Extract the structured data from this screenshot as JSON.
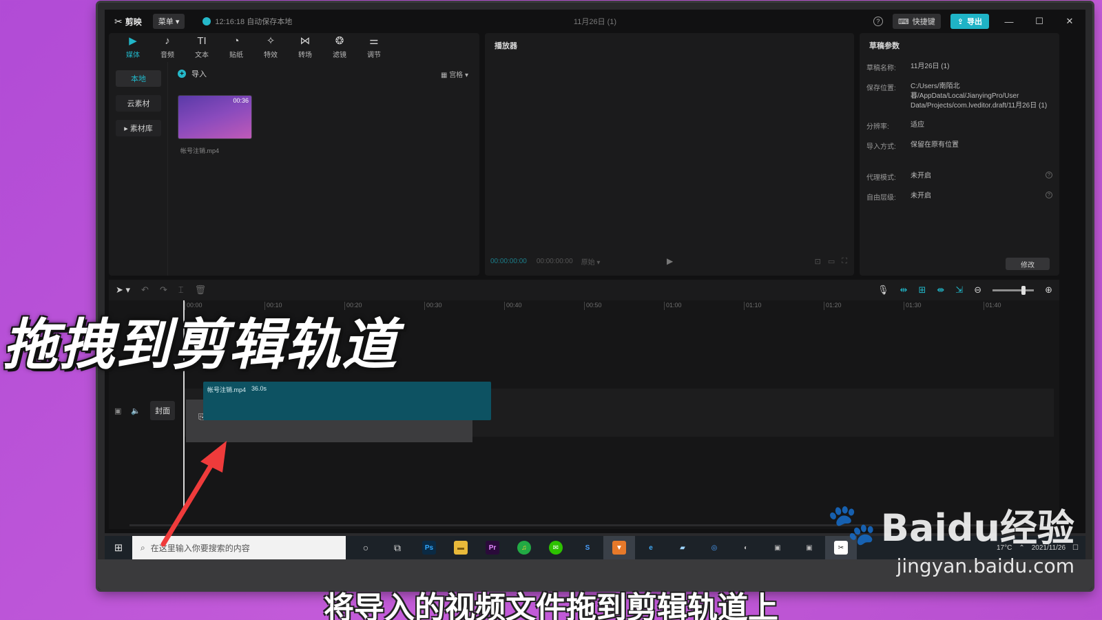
{
  "titlebar": {
    "app_name": "剪映",
    "menu_label": "菜单",
    "saved_status": "12:16:18 自动保存本地",
    "project_title": "11月26日 (1)",
    "shortcut_label": "快捷键",
    "export_label": "导出"
  },
  "media_tabs": [
    {
      "label": "媒体",
      "icon": "media-icon",
      "glyph": "▶"
    },
    {
      "label": "音频",
      "icon": "audio-icon",
      "glyph": "♪"
    },
    {
      "label": "文本",
      "icon": "text-icon",
      "glyph": "TI"
    },
    {
      "label": "贴纸",
      "icon": "sticker-icon",
      "glyph": "◔"
    },
    {
      "label": "特效",
      "icon": "effects-icon",
      "glyph": "✧"
    },
    {
      "label": "转场",
      "icon": "transition-icon",
      "glyph": "⋈"
    },
    {
      "label": "滤镜",
      "icon": "filter-icon",
      "glyph": "❂"
    },
    {
      "label": "调节",
      "icon": "adjust-icon",
      "glyph": "⚌"
    }
  ],
  "media_side": [
    "本地",
    "云素材",
    "▸ 素材库"
  ],
  "media": {
    "import_label": "导入",
    "view_label": "宫格",
    "file_duration": "00:36",
    "file_name": "帐号注销.mp4"
  },
  "player": {
    "title": "播放器",
    "current_time": "00:00:00:00",
    "total_time": "00:00:00:00",
    "ratio_label": "原始"
  },
  "params": {
    "title": "草稿参数",
    "rows": [
      {
        "key": "草稿名称:",
        "value": "11月26日 (1)"
      },
      {
        "key": "保存位置:",
        "value": "C:/Users/南陌北暮/AppData/Local/JianyingPro/User Data/Projects/com.lveditor.draft/11月26日 (1)"
      },
      {
        "key": "分辨率:",
        "value": "适应"
      },
      {
        "key": "导入方式:",
        "value": "保留在原有位置"
      },
      {
        "key": "代理模式:",
        "value": "未开启"
      },
      {
        "key": "自由层级:",
        "value": "未开启"
      }
    ],
    "modify_label": "修改"
  },
  "timeline": {
    "ruler": [
      "00:00",
      "00:10",
      "00:20",
      "00:30",
      "00:40",
      "00:50",
      "01:00",
      "01:10",
      "01:20",
      "01:30",
      "01:40"
    ],
    "cover_label": "封面",
    "clip_name": "帐号注销.mp4",
    "clip_duration": "36.0s",
    "zoom_level": 0.75
  },
  "taskbar": {
    "search_placeholder": "在这里输入你要搜索的内容",
    "temp": "17°C",
    "date": "2021/11/26"
  },
  "overlay": {
    "caption": "拖拽到剪辑轨道",
    "subtitle": "将导入的视频文件拖到剪辑轨道上",
    "watermark_brand": "Baidu经验",
    "watermark_url": "jingyan.baidu.com"
  },
  "colors": {
    "accent": "#21b6c8",
    "clip": "#0d5262",
    "background": "#b14bd6",
    "arrow": "#ef3b3b"
  }
}
